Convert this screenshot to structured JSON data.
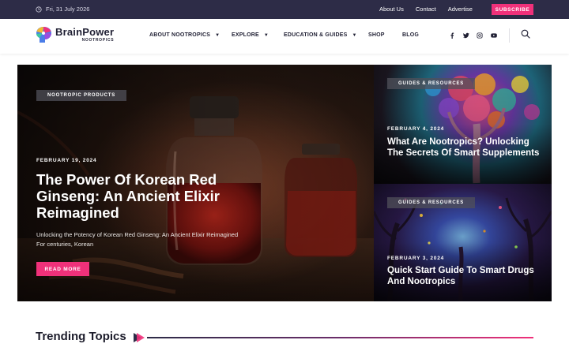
{
  "topbar": {
    "date": "Fri, 31 July 2026",
    "links": [
      "About Us",
      "Contact",
      "Advertise"
    ],
    "subscribe_label": "SUBSCRIBE"
  },
  "header": {
    "brand": "BrainPower",
    "brand_sub": "NOOTROPICS",
    "nav": [
      {
        "label": "ABOUT NOOTROPICS",
        "dropdown": true
      },
      {
        "label": "EXPLORE",
        "dropdown": true
      },
      {
        "label": "EDUCATION & GUIDES",
        "dropdown": true
      },
      {
        "label": "SHOP",
        "dropdown": false
      },
      {
        "label": "BLOG",
        "dropdown": false
      }
    ],
    "social_icons": [
      "facebook-icon",
      "twitter-icon",
      "instagram-icon",
      "youtube-icon"
    ],
    "search_icon": "search-icon"
  },
  "hero": {
    "tag": "NOOTROPIC PRODUCTS",
    "date": "FEBRUARY 19, 2024",
    "title": "The Power Of Korean Red Ginseng: An Ancient Elixir Reimagined",
    "excerpt": "Unlocking the Potency of Korean Red Ginseng: An Ancient Elixir Reimagined For centuries, Korean",
    "read_more": "READ MORE"
  },
  "side_posts": [
    {
      "tag": "GUIDES & RESOURCES",
      "date": "FEBRUARY 4, 2024",
      "title": "What Are Nootropics? Unlocking The Secrets Of Smart Supplements"
    },
    {
      "tag": "GUIDES & RESOURCES",
      "date": "FEBRUARY 3, 2024",
      "title": "Quick Start Guide To Smart Drugs And Nootropics"
    }
  ],
  "trending": {
    "title": "Trending Topics"
  },
  "colors": {
    "topbar_bg": "#2d2c47",
    "accent": "#f0317a",
    "text_dark": "#1f1f33"
  }
}
